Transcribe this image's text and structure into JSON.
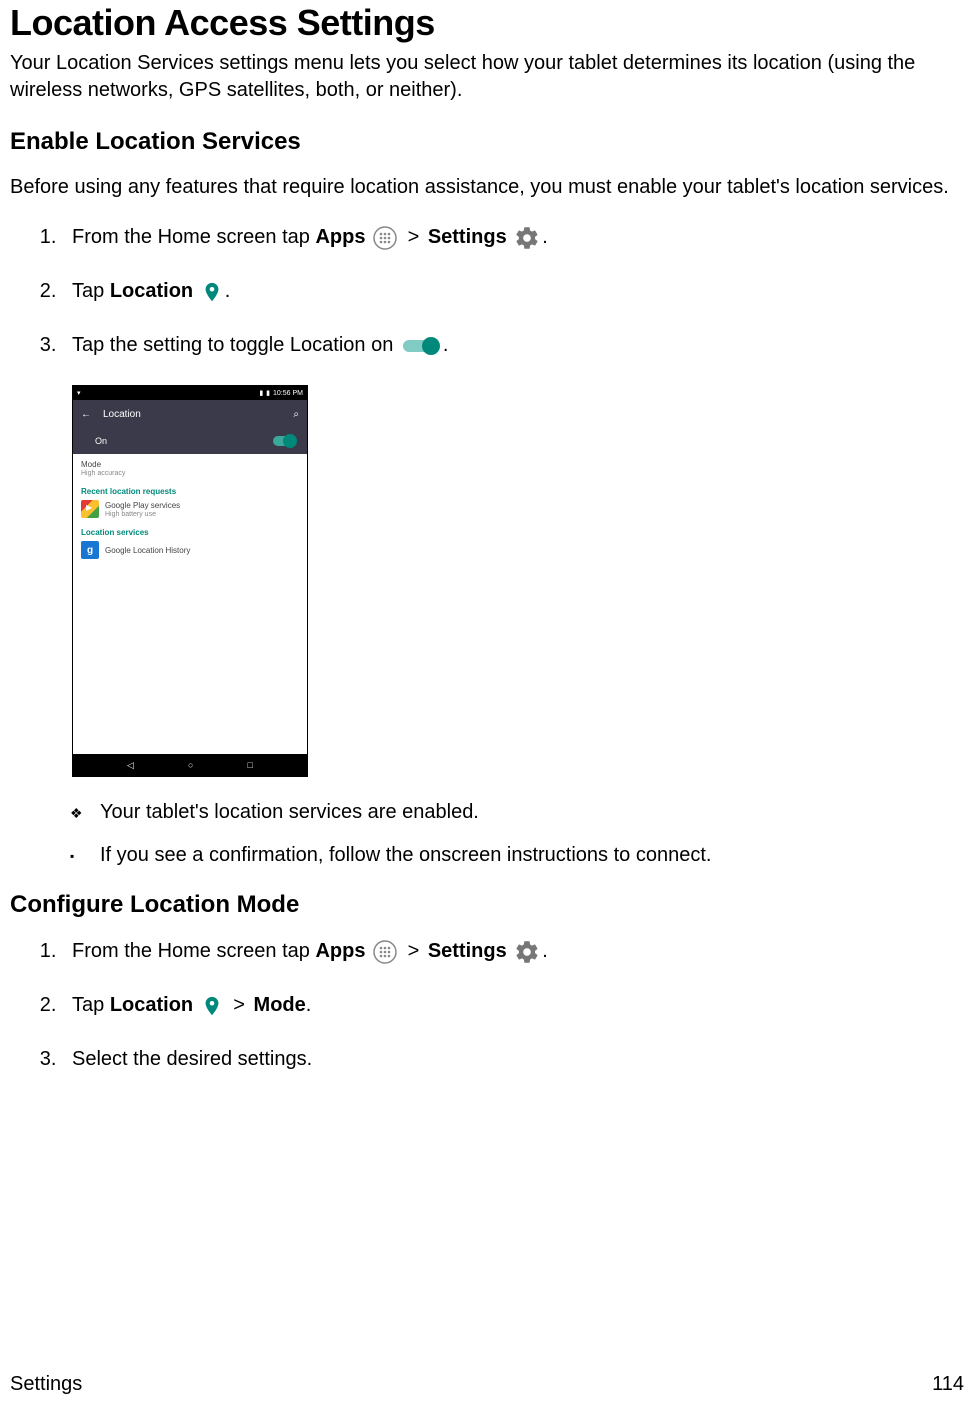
{
  "page_title": "Location Access Settings",
  "intro": "Your Location Services settings menu lets you select how your tablet determines its location (using the wireless networks, GPS satellites, both, or neither).",
  "section1": {
    "heading": "Enable Location Services",
    "lead": "Before using any features that require location assistance, you must enable your tablet's location services.",
    "step1_pre": "From the Home screen tap ",
    "step1_apps": "Apps",
    "step1_gt": ">",
    "step1_settings": "Settings",
    "step1_period": ".",
    "step2_pre": "Tap ",
    "step2_loc": "Location",
    "step2_period": ".",
    "step3_text": "Tap the setting to toggle Location on ",
    "step3_period": ".",
    "bullet_diamond": "Your tablet's location services are enabled.",
    "bullet_square": "If you see a confirmation, follow the onscreen instructions to connect."
  },
  "section2": {
    "heading": "Configure Location Mode",
    "step1_pre": "From the Home screen tap ",
    "step1_apps": "Apps",
    "step1_gt": ">",
    "step1_settings": "Settings",
    "step1_period": ".",
    "step2_pre": "Tap ",
    "step2_loc": "Location",
    "step2_gt": ">",
    "step2_mode": "Mode",
    "step2_period": ".",
    "step3_text": "Select the desired settings."
  },
  "screenshot": {
    "status_time": "10:56 PM",
    "header_title": "Location",
    "on_label": "On",
    "mode_label": "Mode",
    "mode_value": "High accuracy",
    "recent_heading": "Recent location requests",
    "recent_item": "Google Play services",
    "recent_sub": "High battery use",
    "services_heading": "Location services",
    "services_item": "Google Location History"
  },
  "footer": {
    "section": "Settings",
    "page": "114"
  }
}
